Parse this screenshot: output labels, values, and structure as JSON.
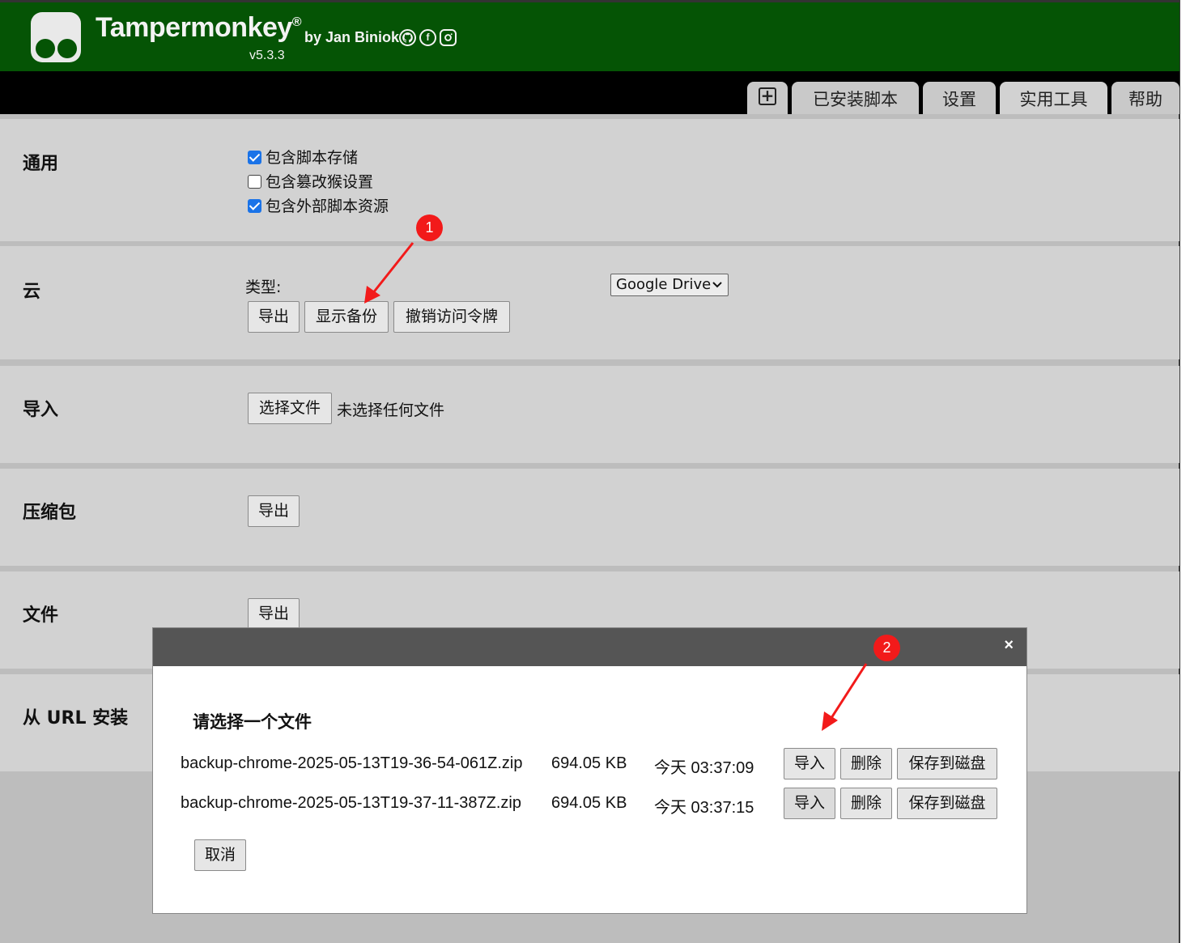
{
  "header": {
    "title": "Tampermonkey",
    "registered": "®",
    "author": "by Jan Biniok",
    "version": "v5.3.3",
    "social_icons": [
      "github-icon",
      "facebook-icon",
      "instagram-icon"
    ],
    "brand_color": "#055405"
  },
  "tabs": {
    "add_icon": "plus-square-icon",
    "items": [
      {
        "label": "已安装脚本"
      },
      {
        "label": "设置"
      },
      {
        "label": "实用工具",
        "active": true
      },
      {
        "label": "帮助"
      }
    ]
  },
  "general": {
    "label": "通用",
    "options": [
      {
        "label": "包含脚本存储",
        "checked": true
      },
      {
        "label": "包含篡改猴设置",
        "checked": false
      },
      {
        "label": "包含外部脚本资源",
        "checked": true
      }
    ]
  },
  "cloud": {
    "label": "云",
    "type_label": "类型:",
    "type_selected": "Google Drive",
    "export_label": "导出",
    "show_backups_label": "显示备份",
    "revoke_label": "撤销访问令牌"
  },
  "import": {
    "label": "导入",
    "choose_file_label": "选择文件",
    "no_file_text": "未选择任何文件"
  },
  "zip": {
    "label": "压缩包",
    "export_label": "导出"
  },
  "file": {
    "label": "文件",
    "export_label": "导出"
  },
  "url": {
    "label": "从 URL 安装"
  },
  "annotations": {
    "badge1": "1",
    "badge2": "2",
    "color": "#f21a1a"
  },
  "modal": {
    "close_glyph": "×",
    "title": "请选择一个文件",
    "files": [
      {
        "name": "backup-chrome-2025-05-13T19-36-54-061Z.zip",
        "size": "694.05 KB",
        "time": "今天 03:37:09"
      },
      {
        "name": "backup-chrome-2025-05-13T19-37-11-387Z.zip",
        "size": "694.05 KB",
        "time": "今天 03:37:15"
      }
    ],
    "import_label": "导入",
    "delete_label": "删除",
    "save_label": "保存到磁盘",
    "cancel_label": "取消"
  }
}
